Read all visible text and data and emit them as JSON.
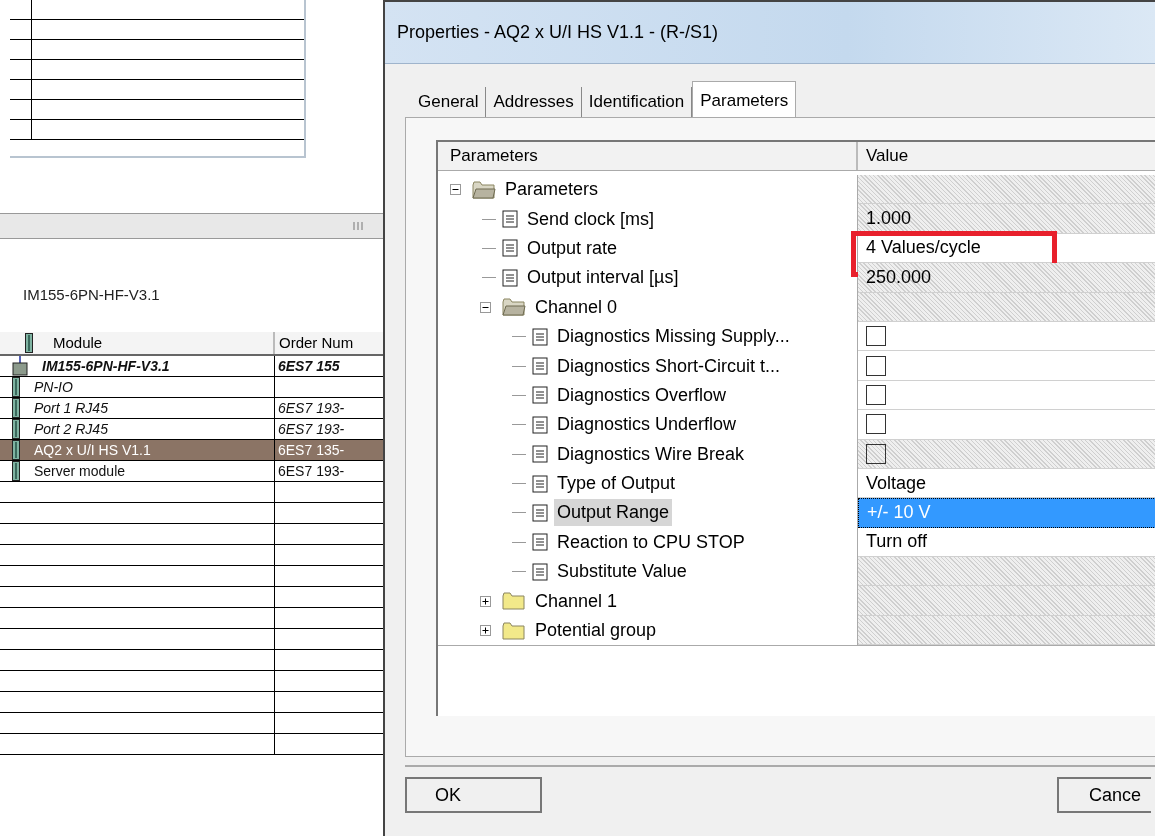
{
  "station": {
    "device_title": "IM155-6PN-HF-V3.1",
    "module_table": {
      "columns": [
        "Module",
        "Order Num"
      ],
      "rows": [
        {
          "kind": "head",
          "module": "IM155-6PN-HF-V3.1",
          "order_number": "6ES7 155",
          "selected": false
        },
        {
          "kind": "interface",
          "module": "PN-IO",
          "selected": false
        },
        {
          "kind": "interface",
          "module": "Port 1 RJ45",
          "order_number": "6ES7 193-",
          "selected": false
        },
        {
          "kind": "interface",
          "module": "Port 2 RJ45",
          "order_number": "6ES7 193-",
          "selected": false
        },
        {
          "kind": "module",
          "module": "AQ2 x U/I HS V1.1",
          "order_number": "6ES7 135-",
          "selected": true
        },
        {
          "kind": "module",
          "module": "Server module",
          "order_number": "6ES7 193-",
          "selected": false
        }
      ]
    }
  },
  "dialog": {
    "title": "Properties - AQ2 x U/I HS V1.1 - (R-/S1)",
    "tabs": [
      {
        "label": "General",
        "selected": false
      },
      {
        "label": "Addresses",
        "selected": false
      },
      {
        "label": "Identification",
        "selected": false
      },
      {
        "label": "Parameters",
        "selected": true
      }
    ],
    "columns": [
      "Parameters",
      "Value"
    ],
    "tree": [
      {
        "kind": "folder",
        "label": "Parameters",
        "expanded": true,
        "disabled": true,
        "selected": false,
        "children": [
          {
            "kind": "item",
            "label": "Send clock [ms]",
            "value": "1.000",
            "disabled": true,
            "selected": false
          },
          {
            "kind": "item",
            "label": "Output rate",
            "value": "4 Values/cycle",
            "disabled": false,
            "selected": false,
            "annotated": true
          },
          {
            "kind": "item",
            "label": "Output interval [µs]",
            "value": "250.000",
            "disabled": true,
            "selected": false
          },
          {
            "kind": "folder",
            "label": "Channel 0",
            "expanded": true,
            "disabled": true,
            "selected": false,
            "children": [
              {
                "kind": "item",
                "label": "Diagnostics Missing Supply...",
                "checked": false,
                "disabled": false,
                "selected": false
              },
              {
                "kind": "item",
                "label": "Diagnostics Short-Circuit t...",
                "checked": false,
                "disabled": false,
                "selected": false
              },
              {
                "kind": "item",
                "label": "Diagnostics Overflow",
                "checked": false,
                "disabled": false,
                "selected": false
              },
              {
                "kind": "item",
                "label": "Diagnostics Underflow",
                "checked": false,
                "disabled": false,
                "selected": false
              },
              {
                "kind": "item",
                "label": "Diagnostics Wire Break",
                "checked": false,
                "disabled": true,
                "selected": false
              },
              {
                "kind": "item",
                "label": "Type of Output",
                "value": "Voltage",
                "disabled": false,
                "selected": false
              },
              {
                "kind": "item",
                "label": "Output Range",
                "value": "+/- 10 V",
                "disabled": false,
                "selected": true
              },
              {
                "kind": "item",
                "label": "Reaction to CPU STOP",
                "value": "Turn off",
                "disabled": false,
                "selected": false
              },
              {
                "kind": "item",
                "label": "Substitute Value",
                "disabled": true,
                "selected": false
              }
            ]
          },
          {
            "kind": "folder",
            "label": "Channel 1",
            "expanded": false,
            "disabled": true,
            "selected": false
          },
          {
            "kind": "folder",
            "label": "Potential group",
            "expanded": false,
            "disabled": true,
            "selected": false
          }
        ]
      }
    ],
    "buttons": [
      "OK",
      "Cance"
    ]
  }
}
